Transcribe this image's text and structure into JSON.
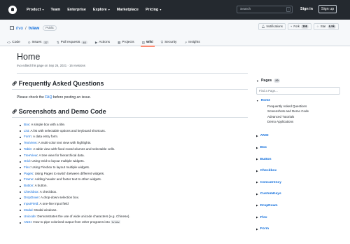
{
  "header": {
    "nav": [
      "Product",
      "Team",
      "Enterprise",
      "Explore",
      "Marketplace",
      "Pricing"
    ],
    "search_placeholder": "Search",
    "search_key": "/",
    "signin": "Sign in",
    "signup": "Sign up"
  },
  "repo": {
    "owner": "rivo",
    "separator": "/",
    "name": "tview",
    "visibility": "Public",
    "notifications": "Notifications",
    "fork_label": "Fork",
    "fork_count": "395",
    "star_label": "Star",
    "star_count": "6.9k"
  },
  "tabs": [
    {
      "label": "Code",
      "icon": "<>",
      "count": ""
    },
    {
      "label": "Issues",
      "icon": "⊙",
      "count": "37"
    },
    {
      "label": "Pull requests",
      "icon": "⇅",
      "count": "40"
    },
    {
      "label": "Actions",
      "icon": "▶",
      "count": ""
    },
    {
      "label": "Projects",
      "icon": "▦",
      "count": ""
    },
    {
      "label": "Wiki",
      "icon": "▤",
      "count": ""
    },
    {
      "label": "Security",
      "icon": "⛨",
      "count": ""
    },
    {
      "label": "Insights",
      "icon": "↗",
      "count": ""
    }
  ],
  "page": {
    "title": "Home",
    "meta": "rivo edited this page on Sep 26, 2021 · 16 revisions",
    "faq_heading": "Frequently Asked Questions",
    "faq_text_before": "Please check the ",
    "faq_link": "FAQ",
    "faq_text_after": " before posting an issue.",
    "shots_heading": "Screenshots and Demo Code",
    "demos": [
      {
        "name": "Box",
        "desc": ": A simple box with a title."
      },
      {
        "name": "List",
        "desc": ": A list with selectable options and keyboard shortcuts."
      },
      {
        "name": "Form",
        "desc": ": A data entry form."
      },
      {
        "name": "TextView",
        "desc": ": A multi-color text view with highlights."
      },
      {
        "name": "Table",
        "desc": ": A table view with fixed rows/columns and selectable cells."
      },
      {
        "name": "TreeView",
        "desc": ": A tree view for hierarchical data."
      },
      {
        "name": "Grid",
        "desc": ": Using Grid to layout multiple widgets."
      },
      {
        "name": "Flex",
        "desc": ": Using Flexbox to layout multiple widgets."
      },
      {
        "name": "Pages",
        "desc": ": Using Pages to switch between different widgets."
      },
      {
        "name": "Frame",
        "desc": ": Adding header and footer text to other widgets."
      },
      {
        "name": "Button",
        "desc": ": A button."
      },
      {
        "name": "Checkbox",
        "desc": ": A checkbox."
      },
      {
        "name": "DropDown",
        "desc": ": A drop-down selection box."
      },
      {
        "name": "InputField",
        "desc": ": A one-line input field"
      },
      {
        "name": "Modal",
        "desc": ": Modal windows."
      },
      {
        "name": "Unicode",
        "desc": ": Demonstrates the use of wide unicode characters (e.g. Chinese)."
      },
      {
        "name": "ANSI",
        "desc": ": How to pipe colorized output from other programs into ",
        "code": "tview"
      }
    ]
  },
  "sidebar": {
    "heading": "Pages",
    "count": "20",
    "find_placeholder": "Find a Page...",
    "home": "Home",
    "home_sections": [
      "Frequently Asked Questions",
      "Screenshots and Demo Code",
      "Advanced Tutorials",
      "Demo Applications"
    ],
    "pages": [
      "ANSI",
      "Box",
      "Button",
      "Checkbox",
      "Concurrency",
      "CustomKeys",
      "DropDown",
      "Flex",
      "Form"
    ]
  },
  "colors": {
    "header_bg": "#24292f",
    "link": "#0969da",
    "tab_underline": "#fd8c73"
  }
}
